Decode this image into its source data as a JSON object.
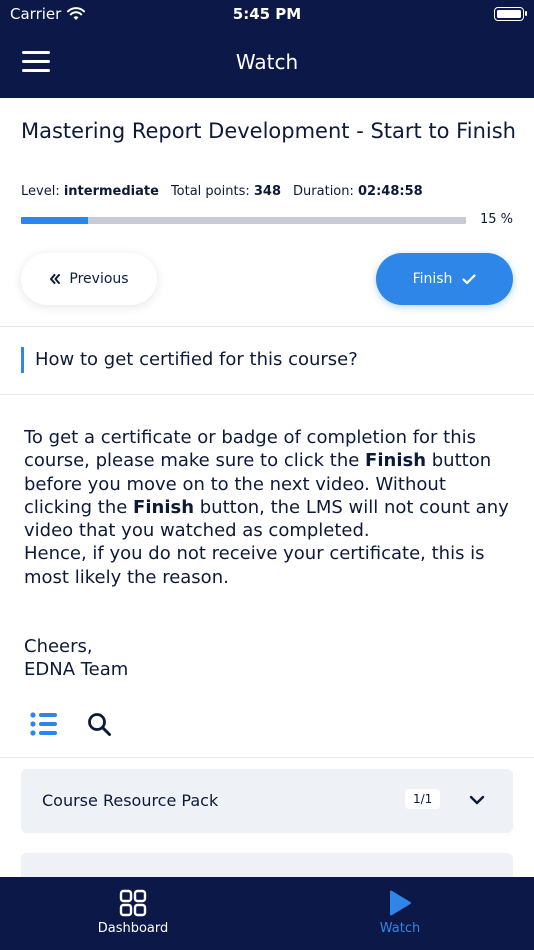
{
  "status_bar": {
    "carrier": "Carrier",
    "time": "5:45 PM"
  },
  "nav": {
    "title": "Watch",
    "menu_icon": "hamburger-icon"
  },
  "course": {
    "title": "Mastering Report Development - Start to Finish",
    "level_label": "Level:",
    "level_value": "intermediate",
    "points_label": "Total points:",
    "points_value": "348",
    "duration_label": "Duration:",
    "duration_value": "02:48:58",
    "progress_percent": 15,
    "progress_label": "15 %"
  },
  "buttons": {
    "previous": "Previous",
    "finish": "Finish"
  },
  "lesson": {
    "heading": "How to get certified for this course?",
    "para1_a": "To get a certificate or badge of completion for this course, please make sure to click the ",
    "para1_bold1": "Finish",
    "para1_b": " button before you move on to the next video. Without clicking the ",
    "para1_bold2": "Finish",
    "para1_c": " button, the LMS will not count any video that you watched as completed.",
    "para2": "Hence, if you do not receive your certificate, this is most likely the reason.",
    "sign1": "Cheers,",
    "sign2": "EDNA Team"
  },
  "toolbar": {
    "list_icon": "list-icon",
    "search_icon": "search-icon"
  },
  "resources": [
    {
      "title": "Course Resource Pack",
      "count": "1/1"
    }
  ],
  "tabs": [
    {
      "label": "Dashboard",
      "icon": "grid-icon",
      "active": false
    },
    {
      "label": "Watch",
      "icon": "play-icon",
      "active": true
    }
  ],
  "colors": {
    "navy": "#0b1848",
    "accent": "#2e86e8",
    "card": "#eef1f5",
    "text": "#0c1a3a"
  }
}
